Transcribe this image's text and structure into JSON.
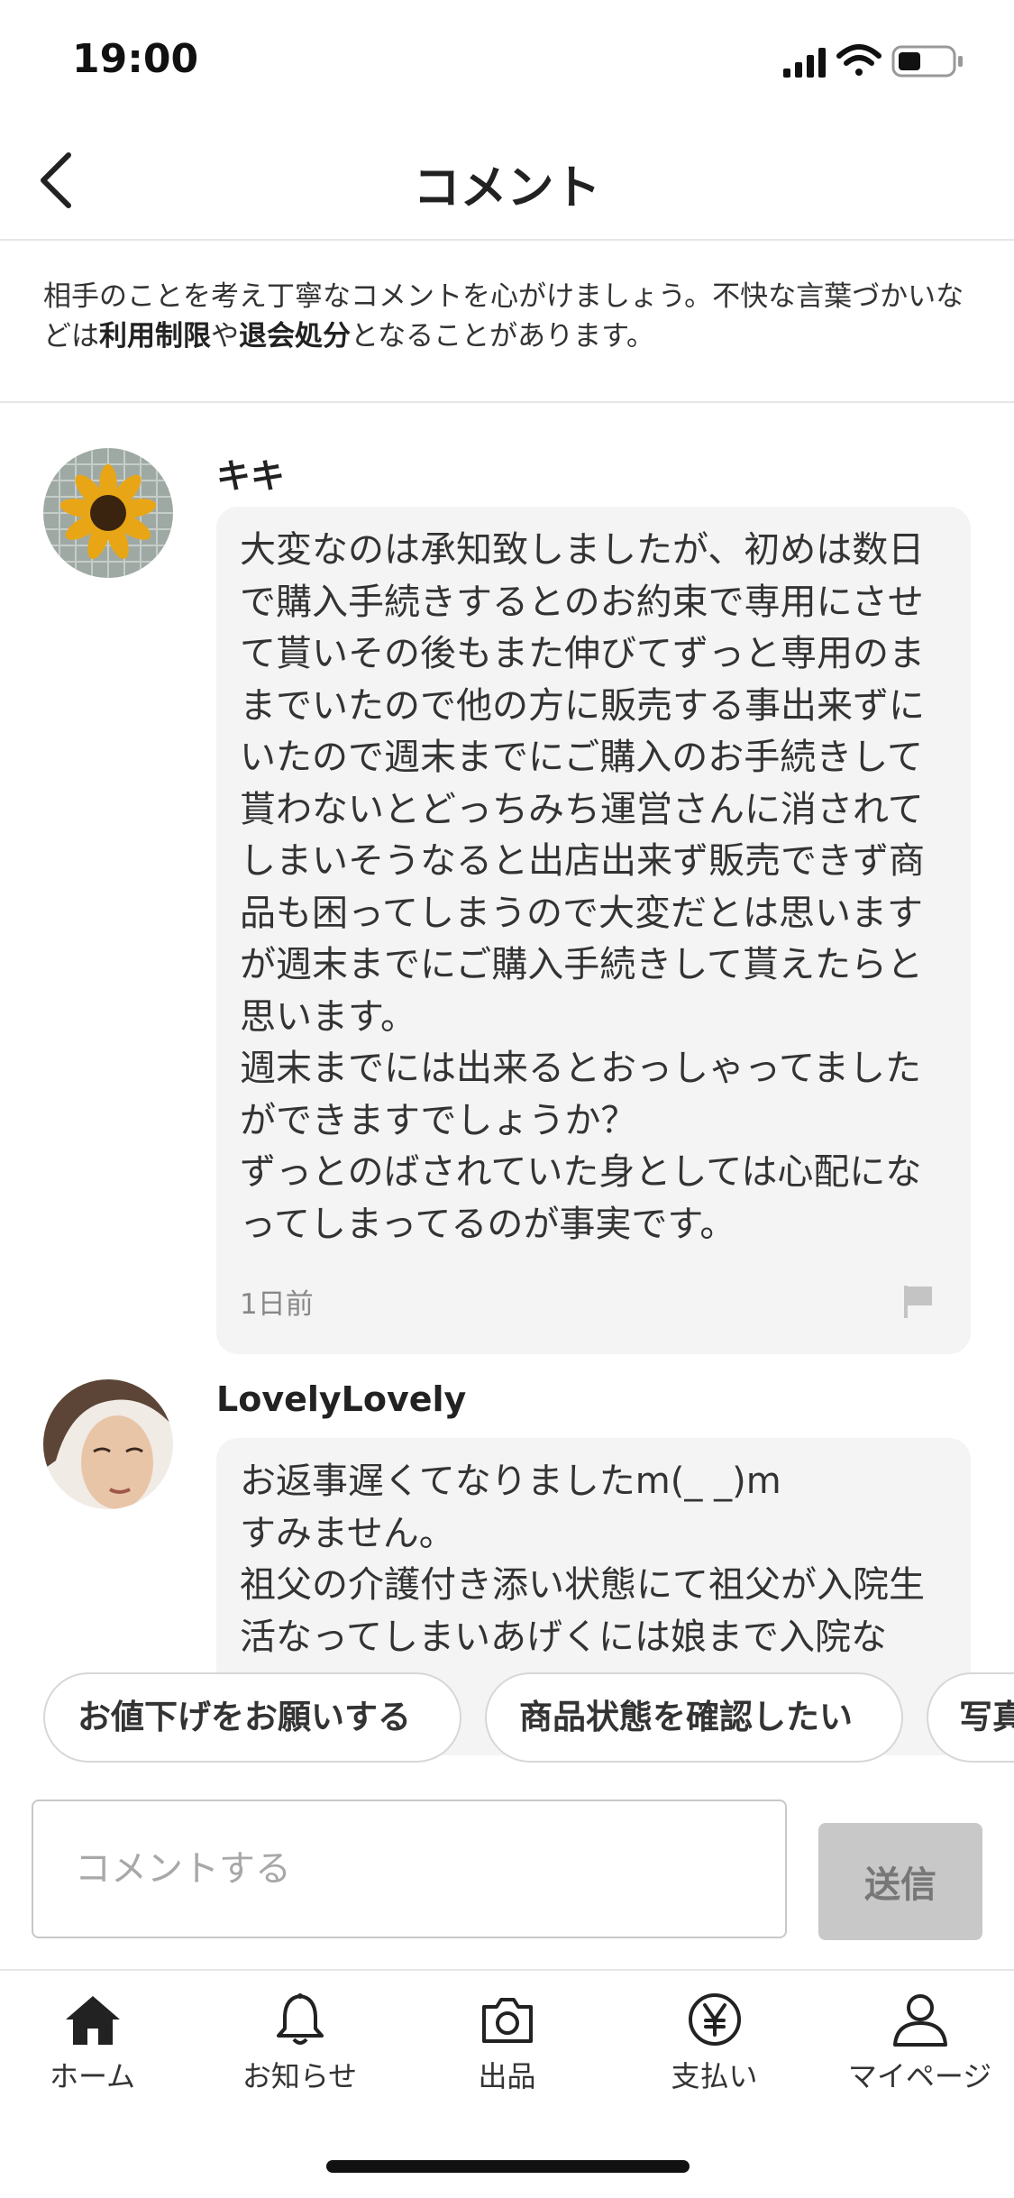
{
  "status_bar": {
    "time": "19:00"
  },
  "header": {
    "title": "コメント"
  },
  "notice": {
    "part1": "相手のことを考え丁寧なコメントを心がけましょう。不快な言葉づかいなどは",
    "bold1": "利用制限",
    "part2": "や",
    "bold2": "退会処分",
    "part3": "となることがあります。"
  },
  "comments": [
    {
      "username": "キキ",
      "avatar_icon": "sunflower-avatar",
      "text": "大変なのは承知致しましたが、初めは数日で購入手続きするとのお約束で専用にさせて貰いその後もまた伸びてずっと専用のままでいたので他の方に販売する事出来ずにいたので週末までにご購入のお手続きして貰わないとどっちみち運営さんに消されてしまいそうなると出店出来ず販売できず商品も困ってしまうので大変だとは思いますが週末までにご購入手続きして貰えたらと思います。\n週末までには出来るとおっしゃってましたができますでしょうか？\nずっとのばされていた身としては心配になってしまってるのが事実です。",
      "time": "1日前"
    },
    {
      "username": "LovelyLovely",
      "avatar_icon": "person-avatar",
      "text": "お返事遅くてなりましたm(_ _)m\nすみません。\n祖父の介護付き添い状態にて祖父が入院生活なってしまいあげくには娘まで入院な"
    }
  ],
  "quick_replies": [
    "お値下げをお願いする",
    "商品状態を確認したい",
    "写真"
  ],
  "input": {
    "placeholder": "コメントする",
    "send_label": "送信"
  },
  "tabs": [
    {
      "label": "ホーム",
      "icon": "home-icon"
    },
    {
      "label": "お知らせ",
      "icon": "bell-icon"
    },
    {
      "label": "出品",
      "icon": "camera-icon"
    },
    {
      "label": "支払い",
      "icon": "yen-icon"
    },
    {
      "label": "マイページ",
      "icon": "person-icon"
    }
  ]
}
